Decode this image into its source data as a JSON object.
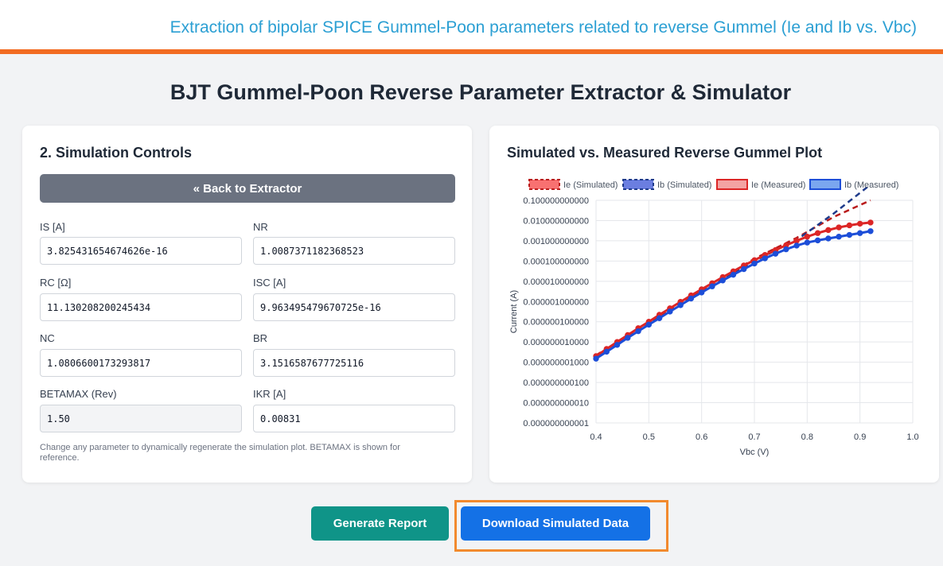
{
  "header": {
    "title": "Extraction of bipolar SPICE Gummel-Poon parameters related to reverse Gummel (Ie and Ib vs. Vbc)"
  },
  "page": {
    "title": "BJT Gummel-Poon Reverse Parameter Extractor & Simulator"
  },
  "controls": {
    "heading": "2. Simulation Controls",
    "back_label": "« Back to Extractor",
    "fields": [
      {
        "label": "IS [A]",
        "value": "3.825431654674626e-16",
        "readonly": false
      },
      {
        "label": "NR",
        "value": "1.0087371182368523",
        "readonly": false
      },
      {
        "label": "RC [Ω]",
        "value": "11.130208200245434",
        "readonly": false
      },
      {
        "label": "ISC [A]",
        "value": "9.963495479670725e-16",
        "readonly": false
      },
      {
        "label": "NC",
        "value": "1.0806600173293817",
        "readonly": false
      },
      {
        "label": "BR",
        "value": "3.1516587677725116",
        "readonly": false
      },
      {
        "label": "BETAMAX (Rev)",
        "value": "1.50",
        "readonly": true
      },
      {
        "label": "IKR [A]",
        "value": "0.00831",
        "readonly": false
      }
    ],
    "note": "Change any parameter to dynamically regenerate the simulation plot. BETAMAX is shown for reference."
  },
  "chart_panel": {
    "heading": "Simulated vs. Measured Reverse Gummel Plot"
  },
  "actions": {
    "report_label": "Generate Report",
    "download_label": "Download Simulated Data"
  },
  "colors": {
    "accent_orange": "#f26b21",
    "header_blue": "#2b9fd3",
    "ie_red": "#dc2626",
    "ib_blue": "#1d4ed8",
    "teal": "#0f9488",
    "primary_blue": "#1471e6"
  },
  "chart_data": {
    "type": "line",
    "xlabel": "Vbc (V)",
    "ylabel": "Current (A)",
    "xlim": [
      0.4,
      1.0
    ],
    "yscale": "log",
    "ylim": [
      1e-12,
      0.1
    ],
    "x_ticks": [
      "0.4",
      "0.5",
      "0.6",
      "0.7",
      "0.8",
      "0.9",
      "1.0"
    ],
    "y_ticks": [
      "0.100000000000",
      "0.010000000000",
      "0.001000000000",
      "0.000100000000",
      "0.000010000000",
      "0.000001000000",
      "0.000000100000",
      "0.000000010000",
      "0.000000001000",
      "0.000000000100",
      "0.000000000010",
      "0.000000000001"
    ],
    "legend_position": "top",
    "series": [
      {
        "name": "Ie (Simulated)",
        "style": "dashed",
        "color": "#b91c1c",
        "x": [
          0.4,
          0.5,
          0.6,
          0.7,
          0.78,
          0.85,
          0.92
        ],
        "y": [
          2.2e-09,
          9.5e-08,
          3.5e-06,
          0.00013,
          0.0014,
          0.015,
          0.1
        ]
      },
      {
        "name": "Ib (Simulated)",
        "style": "dashed",
        "color": "#1e3a8a",
        "x": [
          0.4,
          0.5,
          0.6,
          0.7,
          0.78,
          0.85,
          0.92
        ],
        "y": [
          1.8e-09,
          7.5e-08,
          2.8e-06,
          0.0001,
          0.0011,
          0.022,
          0.6
        ]
      },
      {
        "name": "Ie (Measured)",
        "style": "markers",
        "color": "#dc2626",
        "x": [
          0.4,
          0.42,
          0.44,
          0.46,
          0.48,
          0.5,
          0.52,
          0.54,
          0.56,
          0.58,
          0.6,
          0.62,
          0.64,
          0.66,
          0.68,
          0.7,
          0.72,
          0.74,
          0.76,
          0.78,
          0.8,
          0.82,
          0.84,
          0.86,
          0.88,
          0.9,
          0.92
        ],
        "y": [
          2e-09,
          4.5e-09,
          1e-08,
          2.2e-08,
          4.8e-08,
          1e-07,
          2.2e-07,
          4.6e-07,
          9.6e-07,
          2e-06,
          4e-06,
          8e-06,
          1.6e-05,
          3.1e-05,
          6e-05,
          0.00011,
          0.0002,
          0.00035,
          0.0006,
          0.001,
          0.0016,
          0.0024,
          0.0034,
          0.0046,
          0.0058,
          0.007,
          0.008
        ]
      },
      {
        "name": "Ib (Measured)",
        "style": "markers",
        "color": "#1d4ed8",
        "x": [
          0.4,
          0.42,
          0.44,
          0.46,
          0.48,
          0.5,
          0.52,
          0.54,
          0.56,
          0.58,
          0.6,
          0.62,
          0.64,
          0.66,
          0.68,
          0.7,
          0.72,
          0.74,
          0.76,
          0.78,
          0.8,
          0.82,
          0.84,
          0.86,
          0.88,
          0.9,
          0.92
        ],
        "y": [
          1.5e-09,
          3.3e-09,
          7.2e-09,
          1.6e-08,
          3.4e-08,
          7.2e-08,
          1.5e-07,
          3.2e-07,
          6.6e-07,
          1.4e-06,
          2.8e-06,
          5.6e-06,
          1.1e-05,
          2.1e-05,
          4e-05,
          7.5e-05,
          0.000135,
          0.00023,
          0.00038,
          0.00058,
          0.00082,
          0.00105,
          0.0013,
          0.0016,
          0.00195,
          0.0024,
          0.003
        ]
      }
    ]
  }
}
